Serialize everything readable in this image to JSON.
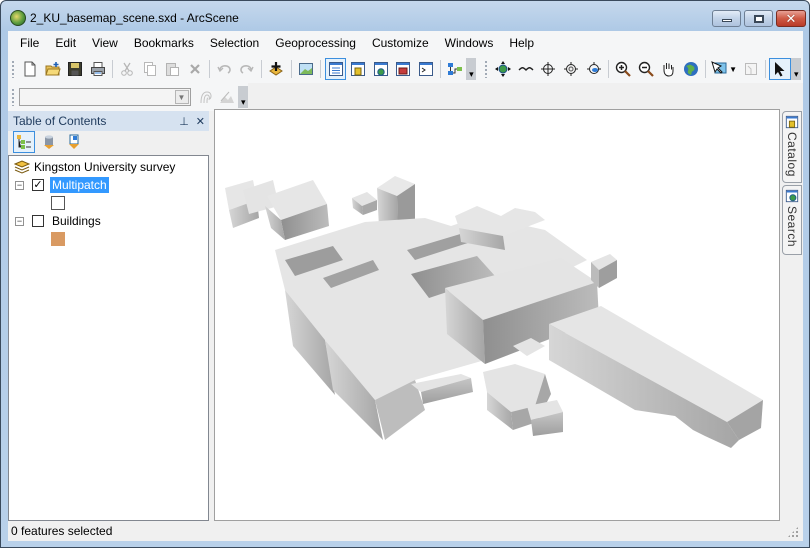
{
  "window": {
    "title": "2_KU_basemap_scene.sxd - ArcScene",
    "buttons": {
      "minimize": "minimize",
      "maximize": "maximize",
      "close": "close"
    }
  },
  "menu": [
    "File",
    "Edit",
    "View",
    "Bookmarks",
    "Selection",
    "Geoprocessing",
    "Customize",
    "Windows",
    "Help"
  ],
  "toolbar_standard": [
    {
      "name": "new-document",
      "icon": "new-document-icon"
    },
    {
      "name": "add-data-open",
      "icon": "open-folder-icon"
    },
    {
      "name": "save",
      "icon": "save-icon"
    },
    {
      "name": "print",
      "icon": "print-icon"
    },
    {
      "name": "cut",
      "icon": "cut-icon",
      "disabled": true
    },
    {
      "name": "copy",
      "icon": "copy-icon",
      "disabled": true
    },
    {
      "name": "paste",
      "icon": "paste-icon",
      "disabled": true
    },
    {
      "name": "delete",
      "icon": "delete-icon",
      "disabled": true
    },
    {
      "name": "undo",
      "icon": "undo-icon",
      "disabled": true
    },
    {
      "name": "redo",
      "icon": "redo-icon",
      "disabled": true
    },
    {
      "name": "add-data",
      "icon": "add-data-icon"
    },
    {
      "name": "full-extent-view",
      "icon": "landscape-icon"
    },
    {
      "name": "table-of-contents",
      "icon": "toc-window-icon",
      "active": true
    },
    {
      "name": "catalog-window",
      "icon": "catalog-window-icon"
    },
    {
      "name": "search-window",
      "icon": "search-window-icon"
    },
    {
      "name": "arctoolbox",
      "icon": "toolbox-window-icon"
    },
    {
      "name": "python-window",
      "icon": "python-window-icon"
    },
    {
      "name": "model-builder",
      "icon": "model-builder-icon"
    }
  ],
  "toolbar_tools": [
    {
      "name": "navigate",
      "icon": "navigate-icon"
    },
    {
      "name": "fly",
      "icon": "fly-icon"
    },
    {
      "name": "center-on-target",
      "icon": "target-icon"
    },
    {
      "name": "zoom-to-target",
      "icon": "zoom-target-icon"
    },
    {
      "name": "set-observer",
      "icon": "observer-icon"
    },
    {
      "name": "zoom-in",
      "icon": "zoom-in-icon"
    },
    {
      "name": "zoom-out",
      "icon": "zoom-out-icon"
    },
    {
      "name": "pan",
      "icon": "pan-hand-icon"
    },
    {
      "name": "full-extent",
      "icon": "globe-icon"
    },
    {
      "name": "select-features",
      "icon": "select-features-icon"
    },
    {
      "name": "clear-selection",
      "icon": "clear-selection-icon",
      "disabled": true
    },
    {
      "name": "select-elements",
      "icon": "arrow-pointer-icon",
      "active": true
    }
  ],
  "toolbar_secondary": {
    "layer_combo_value": "",
    "buttons": [
      {
        "name": "contour",
        "icon": "contour-icon",
        "disabled": true
      },
      {
        "name": "line-of-sight",
        "icon": "line-of-sight-icon",
        "disabled": true
      }
    ]
  },
  "toc": {
    "title": "Table of Contents",
    "tools": [
      "list-by-drawing-order",
      "list-by-source",
      "list-by-visibility"
    ],
    "scene_layer": "Kingston University survey",
    "layers": [
      {
        "name": "Multipatch",
        "checked": true,
        "selected": true,
        "symbol_color": "#ffffff"
      },
      {
        "name": "Buildings",
        "checked": false,
        "selected": false,
        "symbol_color": "#d99a62"
      }
    ]
  },
  "dock_tabs": [
    "Catalog",
    "Search"
  ],
  "status": {
    "text": "0 features selected"
  },
  "colors": {
    "selection": "#3399ff",
    "title_gradient": "#b9d1ea",
    "building_top": "#e6e6e6",
    "building_side": "#9c9c9c"
  }
}
